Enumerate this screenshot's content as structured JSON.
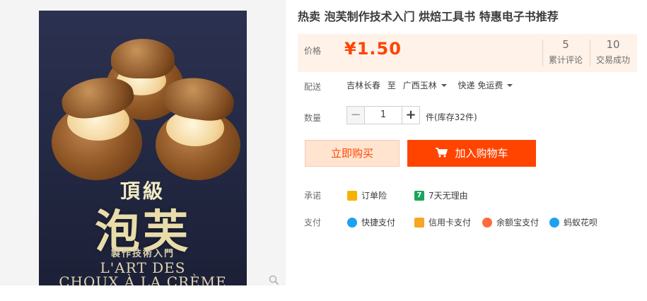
{
  "product": {
    "title": "热卖 泡芙制作技术入门 烘焙工具书 特惠电子书推荐",
    "image": {
      "cover_small_title": "頂級",
      "cover_big_title": "泡芙",
      "cover_subtitle": "製作技術入門",
      "cover_french_line1": "L'ART DES",
      "cover_french_line2": "CHOUX À LA CRÈME"
    }
  },
  "price": {
    "label": "价格",
    "currency": "¥",
    "value": "1.50",
    "reviews_count": "5",
    "reviews_label": "累计评论",
    "deals_count": "10",
    "deals_label": "交易成功"
  },
  "delivery": {
    "label": "配送",
    "from": "吉林长春",
    "to_word": "至",
    "to": "广西玉林",
    "method": "快递 免运费"
  },
  "quantity": {
    "label": "数量",
    "minus": "−",
    "value": "1",
    "plus": "+",
    "unit_stock": "件(库存32件)"
  },
  "actions": {
    "buy_now": "立即购买",
    "add_to_cart": "加入购物车"
  },
  "promise": {
    "label": "承诺",
    "items": [
      "订单险",
      "7天无理由"
    ]
  },
  "payment": {
    "label": "支付",
    "items": [
      "快捷支付",
      "信用卡支付",
      "余额宝支付",
      "蚂蚁花呗"
    ]
  },
  "colors": {
    "accent": "#ff4400",
    "price_panel_bg": "#fff2e8",
    "buy_now_bg": "#ffe4d0"
  },
  "icons": {
    "zoom": "magnifier-icon",
    "cart": "cart-icon",
    "order_insurance": "order-insurance-icon",
    "seven_day": "seven-day-return-icon",
    "quick_pay": "quick-pay-icon",
    "credit_card": "credit-card-icon",
    "yuebao": "yuebao-icon",
    "huabei": "huabei-icon"
  }
}
